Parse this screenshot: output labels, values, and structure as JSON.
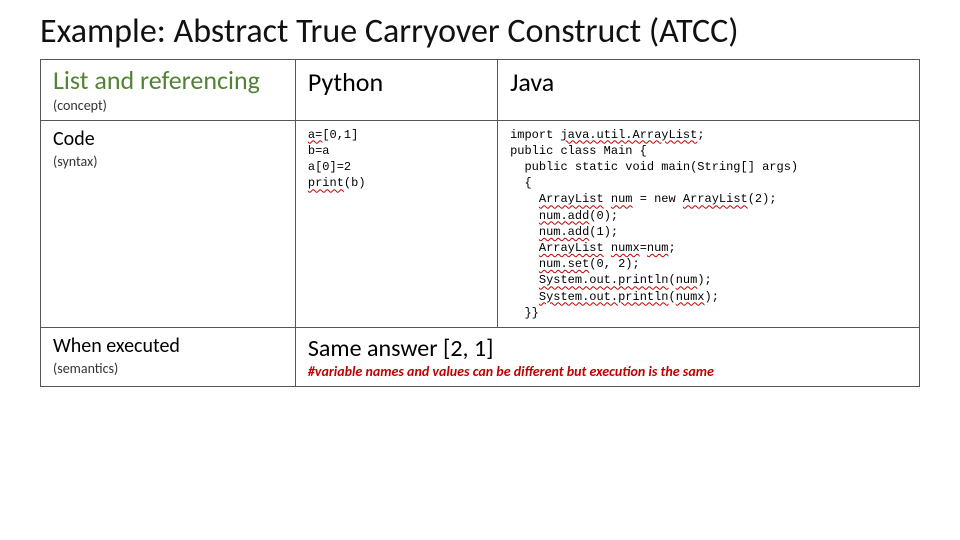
{
  "title": "Example: Abstract True Carryover Construct (ATCC)",
  "header": {
    "concept_main": "List and referencing",
    "concept_sub": "(concept)",
    "lang1": "Python",
    "lang2": "Java"
  },
  "code_row": {
    "label_main": "Code",
    "label_sub": "(syntax)",
    "python": {
      "l1a": "a",
      "l1b": "=",
      "l1c": "[0,1]",
      "l2": "b=a",
      "l3": "a[0]=2",
      "l4a": "print",
      "l4b": "(b)"
    },
    "java": {
      "l1a": "import ",
      "l1b": "java.util.ArrayList",
      "l1c": ";",
      "l2": "public class Main {",
      "l3": "  public static void main(String[] args)",
      "l4": "  {",
      "l5a": "    ",
      "l5b": "ArrayList",
      "l5c": " ",
      "l5d": "num",
      "l5e": " = new ",
      "l5f": "ArrayList",
      "l5g": "(2);",
      "l6a": "    ",
      "l6b": "num.add",
      "l6c": "(0);",
      "l7a": "    ",
      "l7b": "num.add",
      "l7c": "(1);",
      "l8a": "    ",
      "l8b": "ArrayList",
      "l8c": " ",
      "l8d": "numx",
      "l8e": "=",
      "l8f": "num",
      "l8g": ";",
      "l9a": "    ",
      "l9b": "num.set",
      "l9c": "(0, 2);",
      "l10a": "    ",
      "l10b": "System.out.println",
      "l10c": "(",
      "l10d": "num",
      "l10e": ");",
      "l11a": "    ",
      "l11b": "System.out.println",
      "l11c": "(",
      "l11d": "numx",
      "l11e": ");",
      "l12": "  }}"
    }
  },
  "exec_row": {
    "label_main": "When executed",
    "label_sub": "(semantics)",
    "answer_main": "Same answer [2, 1]",
    "answer_note": "#variable names and values can be different but execution is the same"
  }
}
